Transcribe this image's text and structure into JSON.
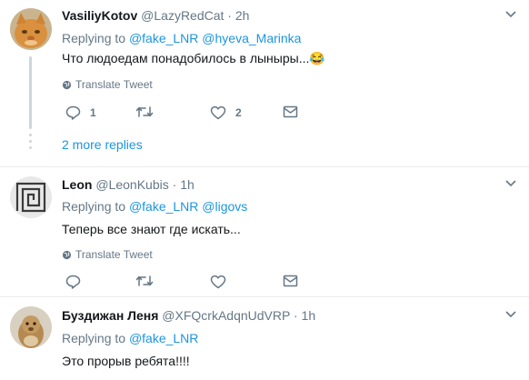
{
  "tweets": [
    {
      "name": "VasiliyKotov",
      "handle": "@LazyRedCat",
      "sep": " · ",
      "time": "2h",
      "replying_prefix": "Replying to ",
      "mentions": [
        "@fake_LNR",
        "@hyeva_Marinka"
      ],
      "text": "Что людоедам понадобилось в лыныры...",
      "emoji": "😂",
      "translate": "Translate Tweet",
      "reply_count": "1",
      "like_count": "2",
      "more_replies": "2 more replies"
    },
    {
      "name": "Leon",
      "handle": "@LeonKubis",
      "sep": " · ",
      "time": "1h",
      "replying_prefix": "Replying to ",
      "mentions": [
        "@fake_LNR",
        "@ligovs"
      ],
      "text": "Теперь все знают где искать...",
      "translate": "Translate Tweet"
    },
    {
      "name": "Буздижан Леня",
      "handle": "@XFQcrkAdqnUdVRP",
      "sep": " · ",
      "time": "1h",
      "replying_prefix": "Replying to ",
      "mentions": [
        "@fake_LNR"
      ],
      "text": "Это прорыв ребята!!!!"
    }
  ],
  "icons": {
    "reply": "reply-icon",
    "retweet": "retweet-icon",
    "like": "heart-icon",
    "dm": "envelope-icon",
    "globe": "globe-icon",
    "caret": "chevron-down-icon"
  },
  "colors": {
    "link": "#1b95e0",
    "muted": "#657786",
    "text": "#14171a",
    "divider": "#e6ecf0",
    "thread": "#ccd6dd"
  }
}
